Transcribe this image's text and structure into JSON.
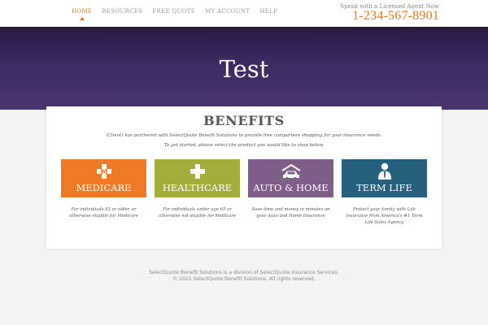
{
  "nav": {
    "items": [
      {
        "label": "HOME",
        "active": true
      },
      {
        "label": "RESOURCES",
        "active": false
      },
      {
        "label": "FREE QUOTE",
        "active": false
      },
      {
        "label": "MY ACCOUNT",
        "active": false
      },
      {
        "label": "HELP",
        "active": false
      }
    ]
  },
  "contact": {
    "label": "Speak with a Licensed Agent Now",
    "phone": "1-234-567-8901",
    "accent": "#e07b1a"
  },
  "hero": {
    "title": "Test"
  },
  "benefits": {
    "title": "BENEFITS",
    "intro_line1": "(Client) has partnered with SelectQuote Benefit Solutions to provide free comparison shopping for your insurance needs.",
    "intro_line2": "To get started, please select the product you would like to shop below.",
    "products": [
      {
        "label": "MEDICARE",
        "icon": "medicare-cross-icon",
        "color": "#ee7a25",
        "description": "For individuals 65 or older, or otherwise eligible for Medicare"
      },
      {
        "label": "HEALTHCARE",
        "icon": "health-cross-icon",
        "color": "#a3ae3a",
        "description": "For individuals under age 65 or otherwise not eligible for Medicare"
      },
      {
        "label": "AUTO & HOME",
        "icon": "car-home-icon",
        "color": "#7f5e89",
        "description": "Save time and money in minutes on your Auto and Home Insurance"
      },
      {
        "label": "TERM LIFE",
        "icon": "person-icon",
        "color": "#26607c",
        "description": "Protect your family with Life Insurance from America's #1 Term Life Sales Agency"
      }
    ]
  },
  "footer": {
    "line1": "SelectQuote Benefit Solutions is a division of SelectQuote Insurance Services.",
    "line2": "© 2015 SelectQuote Benefit Solutions. All rights reserved."
  }
}
